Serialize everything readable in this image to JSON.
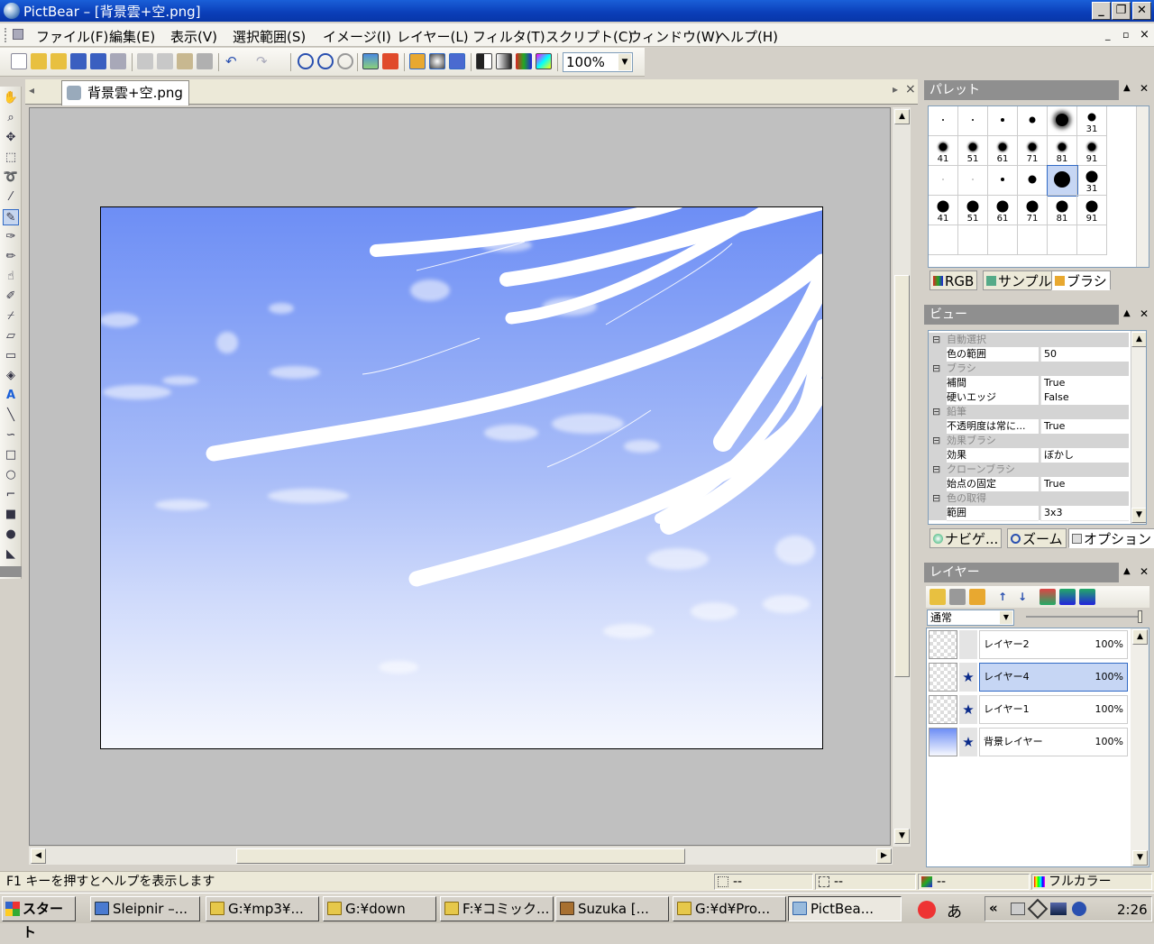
{
  "window": {
    "title": "PictBear – [背景雲+空.png]",
    "minimize": "_",
    "maximize": "❐",
    "close": "✕",
    "doc_min": "_",
    "doc_restore": "▫",
    "doc_close": "×"
  },
  "menu": [
    "ファイル(F)",
    "編集(E)",
    "表示(V)",
    "選択範囲(S)",
    "イメージ(I)",
    "レイヤー(L)",
    "フィルタ(T)",
    "スクリプト(C)",
    "ウィンドウ(W)",
    "ヘルプ(H)"
  ],
  "toolbar": {
    "zoom_value": "100%"
  },
  "document": {
    "tab_label": "背景雲+空.png",
    "nav_prev": "◂",
    "nav_next": "▸",
    "close": "×"
  },
  "palette_panel": {
    "title": "パレット",
    "brush_sizes_row1": [
      "",
      "",
      "",
      "",
      "",
      "31"
    ],
    "brush_sizes_row2": [
      "41",
      "51",
      "61",
      "71",
      "81",
      "91"
    ],
    "brush_sizes_row3": [
      "",
      "",
      "",
      "",
      "",
      "31"
    ],
    "brush_sizes_row4": [
      "41",
      "51",
      "61",
      "71",
      "81",
      "91"
    ],
    "tabs": [
      "RGB",
      "サンプル",
      "ブラシ"
    ]
  },
  "view_panel": {
    "title": "ビュー",
    "rows": [
      {
        "kind": "cat",
        "name": "自動選択"
      },
      {
        "kind": "prop",
        "name": "色の範囲",
        "value": "50"
      },
      {
        "kind": "cat",
        "name": "ブラシ"
      },
      {
        "kind": "prop",
        "name": "補間",
        "value": "True"
      },
      {
        "kind": "prop",
        "name": "硬いエッジ",
        "value": "False"
      },
      {
        "kind": "cat",
        "name": "鉛筆"
      },
      {
        "kind": "prop",
        "name": "不透明度は常に...",
        "value": "True"
      },
      {
        "kind": "cat",
        "name": "効果ブラシ"
      },
      {
        "kind": "prop",
        "name": "効果",
        "value": "ぼかし"
      },
      {
        "kind": "cat",
        "name": "クローンブラシ"
      },
      {
        "kind": "prop",
        "name": "始点の固定",
        "value": "True"
      },
      {
        "kind": "cat",
        "name": "色の取得"
      },
      {
        "kind": "prop",
        "name": "範囲",
        "value": "3x3"
      }
    ],
    "tabs": [
      "ナビゲ...",
      "ズーム",
      "オプション"
    ]
  },
  "layer_panel": {
    "title": "レイヤー",
    "blend_mode": "通常",
    "opacity_level": 1.0,
    "layers": [
      {
        "name": "レイヤー2",
        "opacity": "100%",
        "visible_mark": ""
      },
      {
        "name": "レイヤー4",
        "opacity": "100%",
        "visible_mark": "★"
      },
      {
        "name": "レイヤー1",
        "opacity": "100%",
        "visible_mark": "★"
      },
      {
        "name": "背景レイヤー",
        "opacity": "100%",
        "visible_mark": "★"
      }
    ]
  },
  "statusbar": {
    "help_text": "F1 キーを押すとヘルプを表示します",
    "cursor_pos": "--",
    "selection_size": "--",
    "color_value": "--",
    "color_mode": "フルカラー"
  },
  "taskbar": {
    "start": "スタート",
    "tasks": [
      "Sleipnir –...",
      "G:¥mp3¥...",
      "G:¥down",
      "F:¥コミック...",
      "Suzuka [...",
      "G:¥d¥Pro...",
      "PictBea..."
    ],
    "ime": "あ",
    "clock": "2:26"
  },
  "colors": {
    "titlebar": "#0a3eb8",
    "sky_top": "#6d8ef5",
    "sky_bottom": "#f6f8fe",
    "selected_layer": "#c6d6f4"
  }
}
